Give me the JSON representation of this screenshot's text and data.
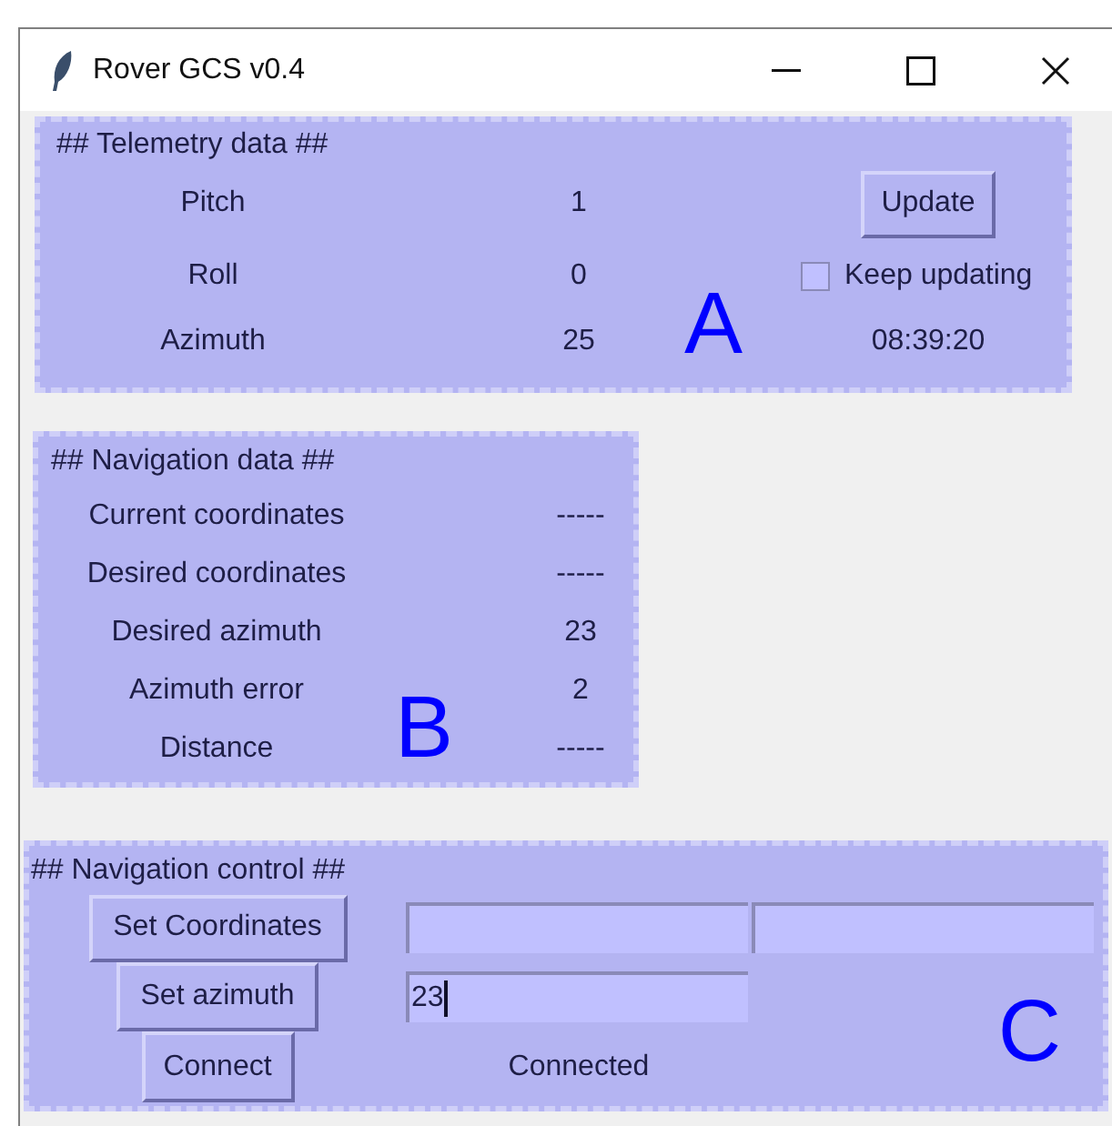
{
  "window": {
    "title": "Rover GCS v0.4"
  },
  "telemetry": {
    "header": "## Telemetry data ##",
    "marker": "A",
    "rows": [
      {
        "label": "Pitch",
        "value": "1"
      },
      {
        "label": "Roll",
        "value": "0"
      },
      {
        "label": "Azimuth",
        "value": "25"
      }
    ],
    "update_button": "Update",
    "keep_updating": {
      "label": "Keep updating",
      "checked": false
    },
    "time": "08:39:20"
  },
  "navigation": {
    "header": "## Navigation data ##",
    "marker": "B",
    "rows": [
      {
        "label": "Current coordinates",
        "value": "-----"
      },
      {
        "label": "Desired coordinates",
        "value": "-----"
      },
      {
        "label": "Desired azimuth",
        "value": "23"
      },
      {
        "label": "Azimuth error",
        "value": "2"
      },
      {
        "label": "Distance",
        "value": "-----"
      }
    ]
  },
  "control": {
    "header": "## Navigation control ##",
    "marker": "C",
    "set_coordinates_button": "Set Coordinates",
    "coordinate_fields": [
      {
        "focused": false
      },
      {
        "focused": false
      }
    ],
    "set_azimuth_button": "Set azimuth",
    "azimuth_field": {
      "value": "23",
      "focused": true
    },
    "connect_button": "Connect",
    "status": "Connected"
  }
}
